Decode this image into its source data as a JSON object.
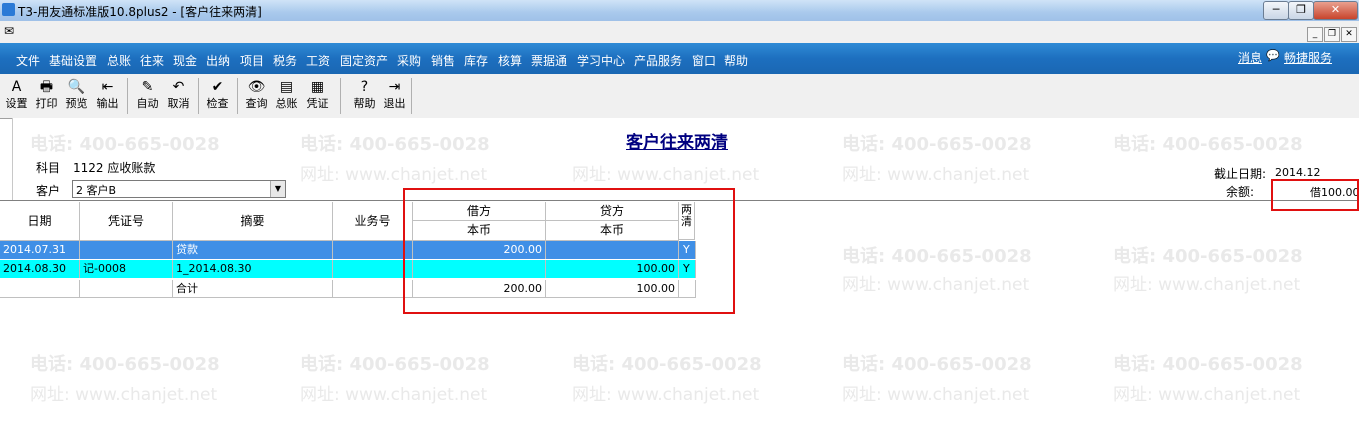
{
  "window": {
    "title": "T3-用友通标准版10.8plus2 - [客户往来两清]",
    "min": "─",
    "max": "❐",
    "close": "✕",
    "mdi_min": "_",
    "mdi_restore": "❐",
    "mdi_close": "✕"
  },
  "menu": {
    "items": [
      "文件",
      "基础设置",
      "总账",
      "往来",
      "现金",
      "出纳",
      "项目",
      "税务",
      "工资",
      "固定资产",
      "采购",
      "销售",
      "库存",
      "核算",
      "票据通",
      "学习中心",
      "产品服务",
      "窗口",
      "帮助"
    ],
    "right": [
      "消息",
      "畅捷服务"
    ]
  },
  "toolbar": {
    "items": [
      {
        "label": "设置",
        "icon": "A"
      },
      {
        "label": "打印",
        "icon": "🖶"
      },
      {
        "label": "预览",
        "icon": "🔍"
      },
      {
        "label": "输出",
        "icon": "⇤"
      },
      {
        "label": "自动",
        "icon": "✎"
      },
      {
        "label": "取消",
        "icon": "↶"
      },
      {
        "label": "检查",
        "icon": "✔"
      },
      {
        "label": "查询",
        "icon": "👁"
      },
      {
        "label": "总账",
        "icon": "▤"
      },
      {
        "label": "凭证",
        "icon": "▦"
      },
      {
        "label": "帮助",
        "icon": "?"
      },
      {
        "label": "退出",
        "icon": "⇥"
      }
    ]
  },
  "watermark": {
    "phone": "电话: 400-665-0028",
    "site": "网址: www.chanjet.net"
  },
  "report": {
    "title": "客户往来两清",
    "subject_label": "科目",
    "subject_value": "1122 应收账款",
    "customer_label": "客户",
    "customer_value": "2  客户B",
    "cutoff_label": "截止日期:",
    "cutoff_value": "2014.12",
    "balance_label": "余额:",
    "balance_value": "借100.00"
  },
  "table": {
    "headers": {
      "date": "日期",
      "voucher": "凭证号",
      "summary": "摘要",
      "business": "业务号",
      "debit": "借方",
      "credit": "贷方",
      "local": "本币",
      "cleared": "两清"
    },
    "rows": [
      {
        "date": "2014.07.31",
        "voucher": "",
        "summary": "贷款",
        "business": "",
        "debit": "200.00",
        "credit": "",
        "cleared": "Y"
      },
      {
        "date": "2014.08.30",
        "voucher": "记-0008",
        "summary": "1_2014.08.30",
        "business": "",
        "debit": "",
        "credit": "100.00",
        "cleared": "Y"
      },
      {
        "date": "",
        "voucher": "",
        "summary": "合计",
        "business": "",
        "debit": "200.00",
        "credit": "100.00",
        "cleared": ""
      }
    ]
  },
  "colors": {
    "row_selected": "#3f8fe6",
    "row_cyan": "#00ffff",
    "highlight_box": "#e01010"
  }
}
